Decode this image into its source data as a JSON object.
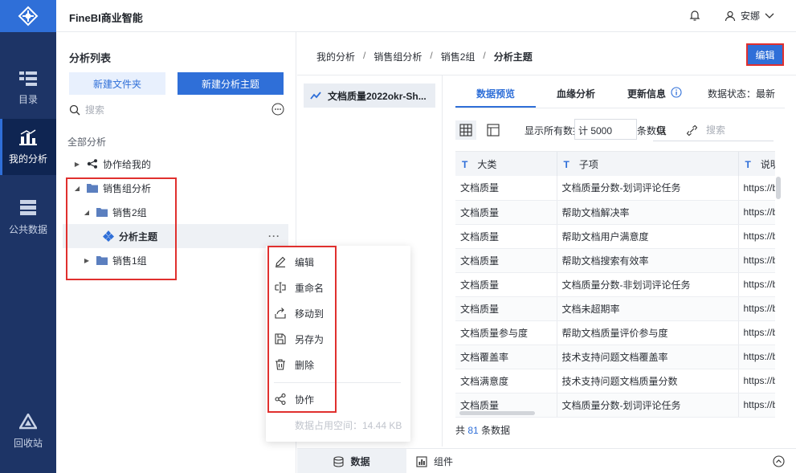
{
  "app": {
    "title": "FineBI商业智能"
  },
  "rail": {
    "items": [
      {
        "label": "目录",
        "icon": "catalog-icon"
      },
      {
        "label": "我的分析",
        "icon": "analysis-chart-icon",
        "active": true
      },
      {
        "label": "公共数据",
        "icon": "database-icon"
      },
      {
        "label": "回收站",
        "icon": "recycle-icon"
      }
    ]
  },
  "header": {
    "user_name": "安娜"
  },
  "left_panel": {
    "title": "分析列表",
    "new_folder_label": "新建文件夹",
    "new_topic_label": "新建分析主题",
    "search_placeholder": "搜索",
    "tree_root": "全部分析",
    "tree": [
      {
        "label": "协作给我的",
        "level": 0,
        "expanded": false
      },
      {
        "label": "销售组分析",
        "level": 0,
        "expanded": true
      },
      {
        "label": "销售2组",
        "level": 1,
        "expanded": true
      },
      {
        "label": "分析主题",
        "level": 2,
        "selected": true
      },
      {
        "label": "销售1组",
        "level": 1,
        "expanded": false
      }
    ],
    "row_more": "···"
  },
  "context_menu": {
    "items": [
      {
        "label": "编辑",
        "icon": "pencil-icon"
      },
      {
        "label": "重命名",
        "icon": "rename-icon"
      },
      {
        "label": "移动到",
        "icon": "move-to-icon"
      },
      {
        "label": "另存为",
        "icon": "save-as-icon"
      },
      {
        "label": "删除",
        "icon": "trash-icon"
      },
      {
        "label": "协作",
        "icon": "share-icon"
      }
    ],
    "storage_text": "数据占用空间：14.44 KB"
  },
  "breadcrumb": [
    "我的分析",
    "销售组分析",
    "销售2组",
    "分析主题"
  ],
  "edit_button_label": "编辑",
  "table_list": {
    "item_label": "文档质量2022okr-Sh..."
  },
  "tabs": {
    "items": [
      "数据预览",
      "血缘分析",
      "更新信息"
    ],
    "status_text": "数据状态：最新",
    "active": 0
  },
  "toolbar": {
    "show_all_text": "显示所有数据",
    "field_value": "计 5000",
    "suffix_text": "条数据",
    "search_placeholder": "搜索"
  },
  "grid": {
    "columns": [
      "大类",
      "子项",
      "说明"
    ],
    "rows": [
      [
        "文档质量",
        "文档质量分数-划词评论任务",
        "https://b"
      ],
      [
        "文档质量",
        "帮助文档解决率",
        "https://b"
      ],
      [
        "文档质量",
        "帮助文档用户满意度",
        "https://b"
      ],
      [
        "文档质量",
        "帮助文档搜索有效率",
        "https://b"
      ],
      [
        "文档质量",
        "文档质量分数-非划词评论任务",
        "https://b"
      ],
      [
        "文档质量",
        "文档未超期率",
        "https://b"
      ],
      [
        "文档质量参与度",
        "帮助文档质量评价参与度",
        "https://b"
      ],
      [
        "文档覆盖率",
        "技术支持问题文档覆盖率",
        "https://b"
      ],
      [
        "文档满意度",
        "技术支持问题文档质量分数",
        "https://b"
      ],
      [
        "文档质量",
        "文档质量分数-划词评论任务",
        "https://b"
      ]
    ],
    "count_prefix": "共",
    "count_value": "81",
    "count_suffix": "条数据"
  },
  "bottom_tabs": {
    "data_label": "数据",
    "component_label": "组件"
  },
  "colors": {
    "accent": "#2f6fd8",
    "rail": "#1d3466",
    "highlight_border": "#e0302e"
  }
}
